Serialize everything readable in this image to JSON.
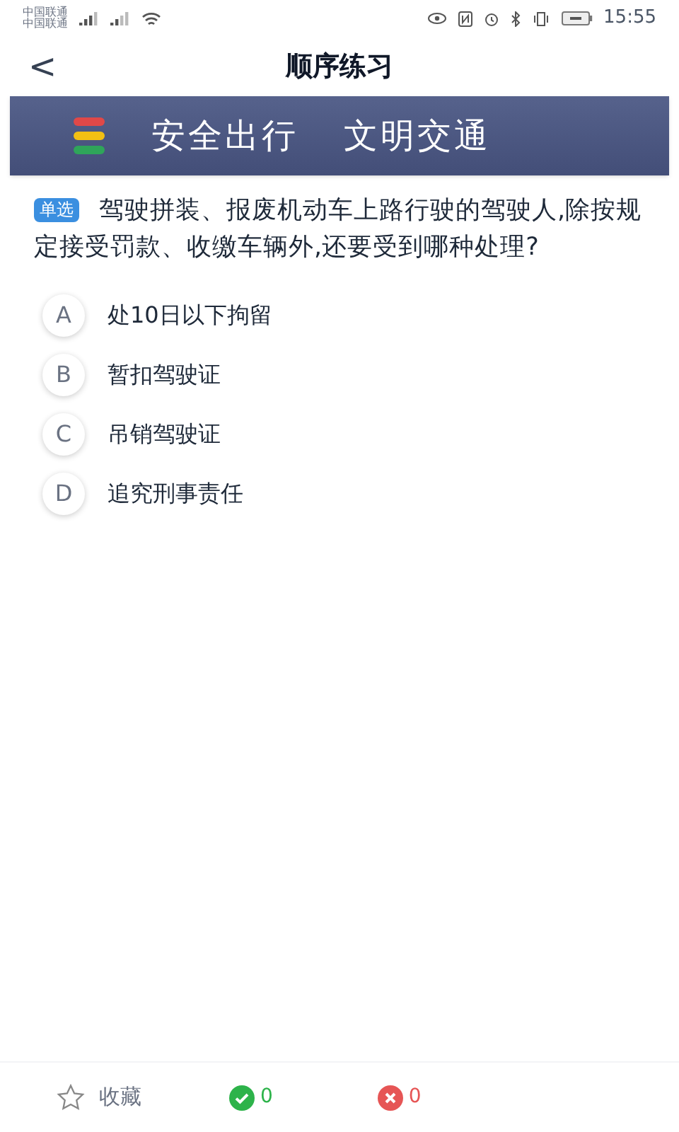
{
  "status_bar": {
    "carriers": [
      "中国联通",
      "中国联通"
    ],
    "time": "15:55"
  },
  "header": {
    "back": "<",
    "title": "顺序练习"
  },
  "banner": {
    "left": "安全出行",
    "right": "文明交通"
  },
  "question": {
    "type_badge": "单选",
    "text": "驾驶拼装、报废机动车上路行驶的驾驶人,除按规定接受罚款、收缴车辆外,还要受到哪种处理?"
  },
  "options": [
    {
      "letter": "A",
      "text": "处10日以下拘留"
    },
    {
      "letter": "B",
      "text": "暂扣驾驶证"
    },
    {
      "letter": "C",
      "text": "吊销驾驶证"
    },
    {
      "letter": "D",
      "text": "追究刑事责任"
    }
  ],
  "bottom_bar": {
    "favorite": "收藏",
    "correct_count": "0",
    "wrong_count": "0"
  }
}
